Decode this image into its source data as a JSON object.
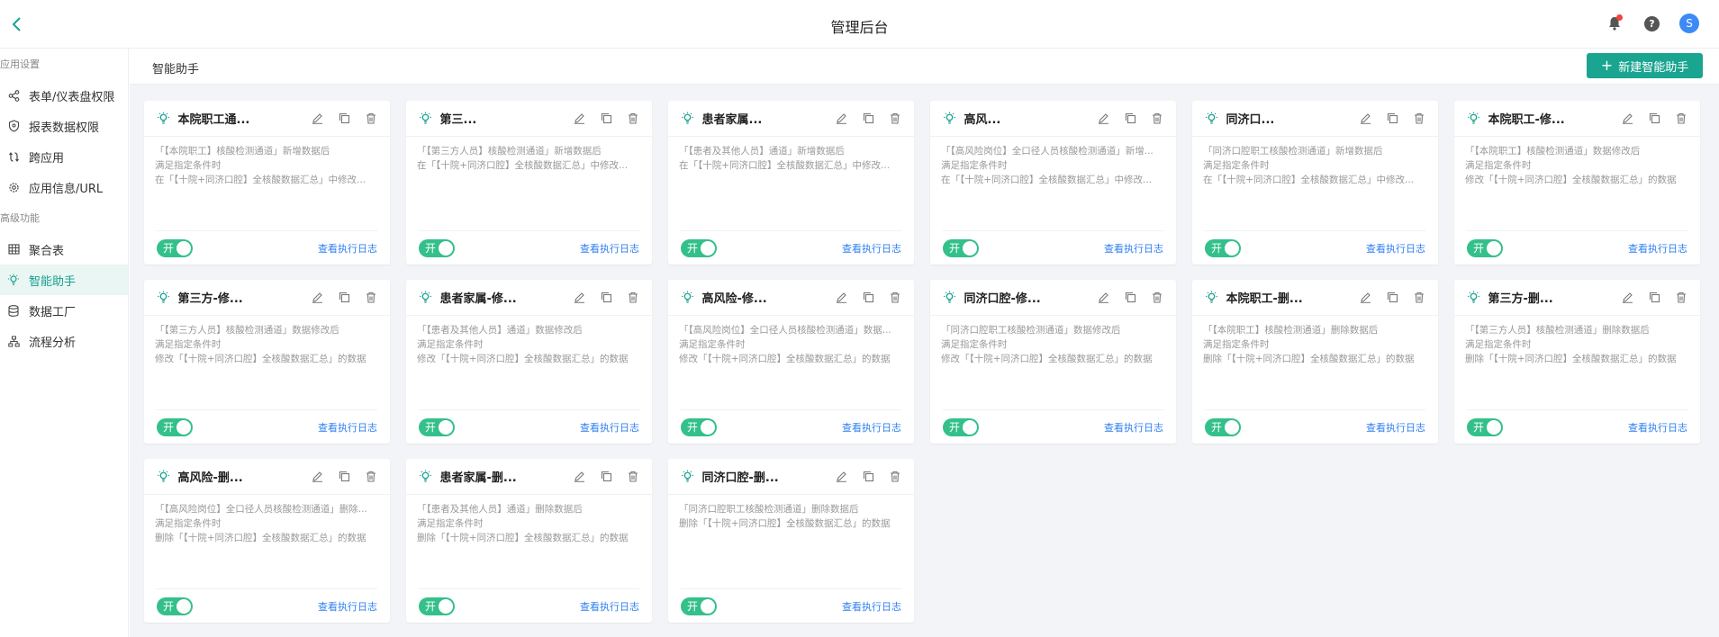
{
  "header": {
    "title": "管理后台",
    "avatar_letter": "S"
  },
  "sidebar": {
    "groups": [
      {
        "label": "应用设置",
        "items": [
          {
            "label": "表单/仪表盘权限",
            "icon": "share-icon"
          },
          {
            "label": "报表数据权限",
            "icon": "shield-icon"
          },
          {
            "label": "跨应用",
            "icon": "link-icon"
          },
          {
            "label": "应用信息/URL",
            "icon": "gear-icon"
          }
        ]
      },
      {
        "label": "高级功能",
        "items": [
          {
            "label": "聚合表",
            "icon": "table-icon"
          },
          {
            "label": "智能助手",
            "icon": "bulb-icon",
            "active": true
          },
          {
            "label": "数据工厂",
            "icon": "database-icon"
          },
          {
            "label": "流程分析",
            "icon": "flow-icon"
          }
        ]
      }
    ]
  },
  "content": {
    "title": "智能助手",
    "new_button": "新建智能助手"
  },
  "cards": [
    {
      "name": "本院职工通...",
      "lines": [
        "「【本院职工】核酸检测通道」新增数据后",
        "满足指定条件时",
        "在「【十院+同济口腔】全核酸数据汇总」中修改..."
      ],
      "toggle": "开",
      "log": "查看执行日志"
    },
    {
      "name": "第三...",
      "lines": [
        "「【第三方人员】核酸检测通道」新增数据后",
        "在「【十院+同济口腔】全核酸数据汇总」中修改..."
      ],
      "toggle": "开",
      "log": "查看执行日志"
    },
    {
      "name": "患者家属...",
      "lines": [
        "「【患者及其他人员】通道」新增数据后",
        "在「【十院+同济口腔】全核酸数据汇总」中修改..."
      ],
      "toggle": "开",
      "log": "查看执行日志"
    },
    {
      "name": "高风...",
      "lines": [
        "「【高风险岗位】全口径人员核酸检测通道」新增...",
        "满足指定条件时",
        "在「【十院+同济口腔】全核酸数据汇总」中修改..."
      ],
      "toggle": "开",
      "log": "查看执行日志"
    },
    {
      "name": "同济口...",
      "lines": [
        "「同济口腔职工核酸检测通道」新增数据后",
        "满足指定条件时",
        "在「【十院+同济口腔】全核酸数据汇总」中修改..."
      ],
      "toggle": "开",
      "log": "查看执行日志"
    },
    {
      "name": "本院职工-修...",
      "lines": [
        "「【本院职工】核酸检测通道」数据修改后",
        "满足指定条件时",
        "修改「【十院+同济口腔】全核酸数据汇总」的数据"
      ],
      "toggle": "开",
      "log": "查看执行日志"
    },
    {
      "name": "第三方-修...",
      "lines": [
        "「【第三方人员】核酸检测通道」数据修改后",
        "满足指定条件时",
        "修改「【十院+同济口腔】全核酸数据汇总」的数据"
      ],
      "toggle": "开",
      "log": "查看执行日志"
    },
    {
      "name": "患者家属-修...",
      "lines": [
        "「【患者及其他人员】通道」数据修改后",
        "满足指定条件时",
        "修改「【十院+同济口腔】全核酸数据汇总」的数据"
      ],
      "toggle": "开",
      "log": "查看执行日志"
    },
    {
      "name": "高风险-修...",
      "lines": [
        "「【高风险岗位】全口径人员核酸检测通道」数据...",
        "满足指定条件时",
        "修改「【十院+同济口腔】全核酸数据汇总」的数据"
      ],
      "toggle": "开",
      "log": "查看执行日志"
    },
    {
      "name": "同济口腔-修...",
      "lines": [
        "「同济口腔职工核酸检测通道」数据修改后",
        "满足指定条件时",
        "修改「【十院+同济口腔】全核酸数据汇总」的数据"
      ],
      "toggle": "开",
      "log": "查看执行日志"
    },
    {
      "name": "本院职工-删...",
      "lines": [
        "「【本院职工】核酸检测通道」删除数据后",
        "满足指定条件时",
        "删除「【十院+同济口腔】全核酸数据汇总」的数据"
      ],
      "toggle": "开",
      "log": "查看执行日志"
    },
    {
      "name": "第三方-删...",
      "lines": [
        "「【第三方人员】核酸检测通道」删除数据后",
        "满足指定条件时",
        "删除「【十院+同济口腔】全核酸数据汇总」的数据"
      ],
      "toggle": "开",
      "log": "查看执行日志"
    },
    {
      "name": "高风险-删...",
      "lines": [
        "「【高风险岗位】全口径人员核酸检测通道」删除...",
        "满足指定条件时",
        "删除「【十院+同济口腔】全核酸数据汇总」的数据"
      ],
      "toggle": "开",
      "log": "查看执行日志"
    },
    {
      "name": "患者家属-删...",
      "lines": [
        "「【患者及其他人员】通道」删除数据后",
        "满足指定条件时",
        "删除「【十院+同济口腔】全核酸数据汇总」的数据"
      ],
      "toggle": "开",
      "log": "查看执行日志"
    },
    {
      "name": "同济口腔-删...",
      "lines": [
        "「同济口腔职工核酸检测通道」删除数据后",
        "删除「【十院+同济口腔】全核酸数据汇总」的数据"
      ],
      "toggle": "开",
      "log": "查看执行日志"
    }
  ],
  "colors": {
    "accent": "#1aa591",
    "toggle_on": "#34c08a",
    "link": "#2f7ff0",
    "notification_dot": "#f5413b"
  }
}
